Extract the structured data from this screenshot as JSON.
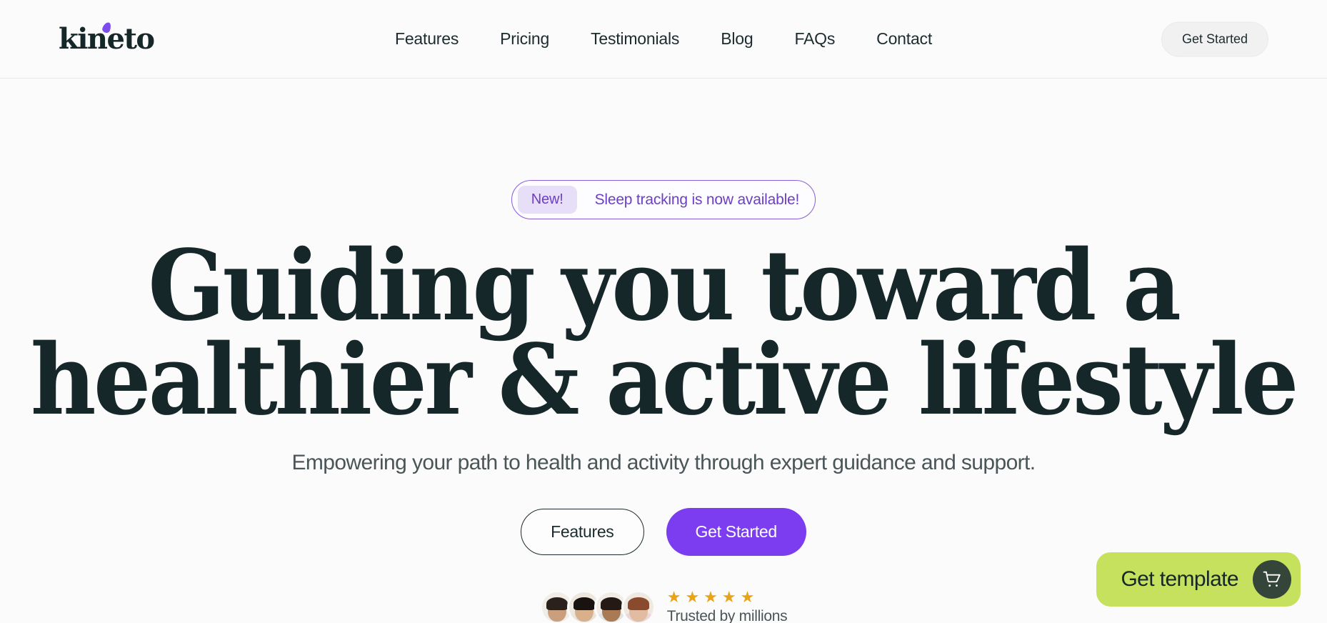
{
  "brand": {
    "logo_text": "kineto",
    "accent_color": "#7C4DEE",
    "dark_color": "#16272A",
    "lime_color": "#C6E15D",
    "star_color": "#E8A317"
  },
  "header": {
    "nav_items": [
      {
        "label": "Features",
        "icon": "nav-link-icon"
      },
      {
        "label": "Pricing",
        "icon": "nav-link-icon"
      },
      {
        "label": "Testimonials",
        "icon": "nav-link-icon"
      },
      {
        "label": "Blog",
        "icon": "nav-link-icon"
      },
      {
        "label": "FAQs",
        "icon": "nav-link-icon"
      },
      {
        "label": "Contact",
        "icon": "nav-link-icon"
      }
    ],
    "cta_label": "Get Started"
  },
  "hero": {
    "badge": {
      "chip_label": "New!",
      "message": "Sleep tracking is now available!",
      "border_color": "#8B5CD6",
      "chip_bg": "#E7DEF8",
      "text_color": "#6D3FC4"
    },
    "headline_line1": "Guiding you toward a",
    "headline_line2": "healthier & active lifestyle",
    "subtitle": "Empowering your path to health and activity through expert guidance and support.",
    "buttons": {
      "secondary_label": "Features",
      "primary_label": "Get Started",
      "primary_color": "#7C3DF0"
    },
    "social_proof": {
      "avatars": [
        {
          "name": "avatar-person-1",
          "skin": "#C99F7E",
          "hair": "#2B211C",
          "shirt": "#EFEDE9",
          "bg": "#F2EDE5"
        },
        {
          "name": "avatar-person-2",
          "skin": "#D9B08C",
          "hair": "#181310",
          "shirt": "#E8E4DE",
          "bg": "#EDE7DE"
        },
        {
          "name": "avatar-person-3",
          "skin": "#A97A54",
          "hair": "#241A13",
          "shirt": "#DEE5E8",
          "bg": "#F1EDE6"
        },
        {
          "name": "avatar-person-4",
          "skin": "#E2BCA0",
          "hair": "#8A4A2E",
          "shirt": "#EBD6DA",
          "bg": "#EFE9E1"
        }
      ],
      "star_count": 5,
      "star_glyph": "★",
      "trusted_label": "Trusted by millions"
    }
  },
  "floating_widget": {
    "label": "Get template",
    "cart_icon": "shopping-cart-icon",
    "bg_color": "#C6E15D",
    "circle_color": "#36453A"
  }
}
